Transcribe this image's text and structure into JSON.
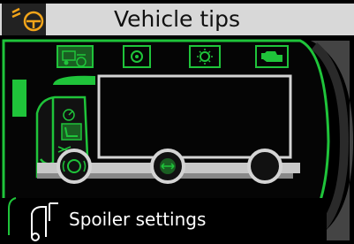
{
  "header": {
    "title": "Vehicle tips",
    "status_icon": "speedometer-with-warning-icon"
  },
  "category_tabs": [
    {
      "icon": "truck-maintenance-icon",
      "active": true
    },
    {
      "icon": "gear-settings-icon",
      "active": false
    },
    {
      "icon": "sun-climate-icon",
      "active": false
    },
    {
      "icon": "engine-icon",
      "active": false
    }
  ],
  "vehicle_hotspots": [
    {
      "icon": "gauge-icon"
    },
    {
      "icon": "seat-icon"
    },
    {
      "icon": "brake-icon"
    },
    {
      "icon": "tyre-pressure-icon"
    }
  ],
  "footer": {
    "label": "Spoiler settings",
    "icon": "cab-spoiler-icon"
  },
  "colors": {
    "accent": "#1fc43a",
    "background": "#000000",
    "header": "#d8d8d8",
    "truck_outline": "#d4d4d4"
  }
}
